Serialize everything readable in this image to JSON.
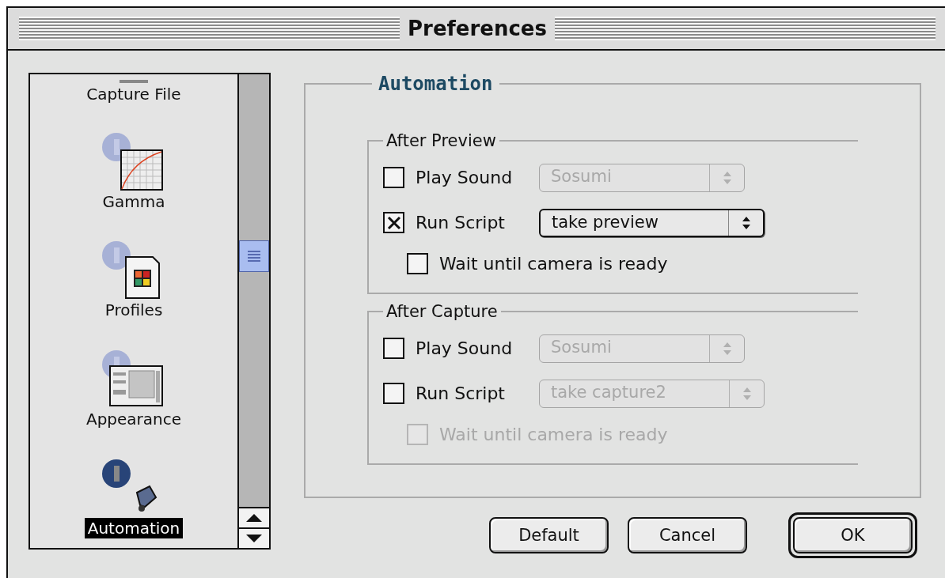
{
  "window": {
    "title": "Preferences"
  },
  "sidebar": {
    "items": [
      {
        "label": "Capture File",
        "kind": "capture",
        "selected": false
      },
      {
        "label": "Gamma",
        "kind": "gamma",
        "selected": false
      },
      {
        "label": "Profiles",
        "kind": "profiles",
        "selected": false
      },
      {
        "label": "Appearance",
        "kind": "appearance",
        "selected": false
      },
      {
        "label": "Automation",
        "kind": "automation",
        "selected": true
      }
    ]
  },
  "panel": {
    "title": "Automation",
    "groups": [
      {
        "title": "After Preview",
        "rows": [
          {
            "kind": "sound",
            "label": "Play Sound",
            "checked": false,
            "disabled": false,
            "popup": {
              "value": "Sosumi",
              "disabled": true
            }
          },
          {
            "kind": "script",
            "label": "Run Script",
            "checked": true,
            "disabled": false,
            "popup": {
              "value": "take preview",
              "disabled": false
            }
          },
          {
            "kind": "wait",
            "label": "Wait until camera is ready",
            "checked": false,
            "disabled": false
          }
        ]
      },
      {
        "title": "After Capture",
        "rows": [
          {
            "kind": "sound",
            "label": "Play Sound",
            "checked": false,
            "disabled": false,
            "popup": {
              "value": "Sosumi",
              "disabled": true
            }
          },
          {
            "kind": "script",
            "label": "Run Script",
            "checked": false,
            "disabled": false,
            "popup": {
              "value": "take capture2",
              "disabled": true
            }
          },
          {
            "kind": "wait",
            "label": "Wait until camera is ready",
            "checked": false,
            "disabled": true
          }
        ]
      }
    ]
  },
  "buttons": [
    {
      "label": "Default",
      "default": false
    },
    {
      "label": "Cancel",
      "default": false
    },
    {
      "label": "OK",
      "default": true
    }
  ]
}
